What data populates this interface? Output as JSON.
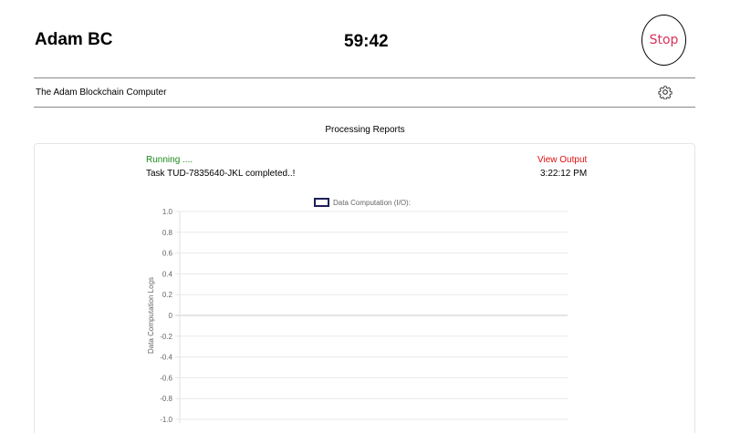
{
  "header": {
    "app_title": "Adam BC",
    "timer": "59:42",
    "stop_label": "Stop",
    "subtitle": "The Adam Blockchain Computer",
    "settings_icon": "gear-icon"
  },
  "reports": {
    "section_title": "Processing Reports",
    "status": "Running ....",
    "view_output_label": "View Output",
    "task_message": "Task TUD-7835640-JKL completed..!",
    "time": "3:22:12 PM"
  },
  "colors": {
    "stop": "#d9305a",
    "status": "#1a8a1a",
    "view_output": "#e01010",
    "legend_border": "#1e1e5a"
  },
  "chart_data": {
    "type": "line",
    "ylabel": "Data Computation Logs",
    "ylim": [
      -1.0,
      1.0
    ],
    "yticks": [
      "1.0",
      "0.8",
      "0.6",
      "0.4",
      "0.2",
      "0",
      "-0.2",
      "-0.4",
      "-0.6",
      "-0.8",
      "-1.0"
    ],
    "grid": true,
    "legend_position": "top",
    "series": [
      {
        "name": "Data Computation (I/O):",
        "values": []
      }
    ]
  }
}
